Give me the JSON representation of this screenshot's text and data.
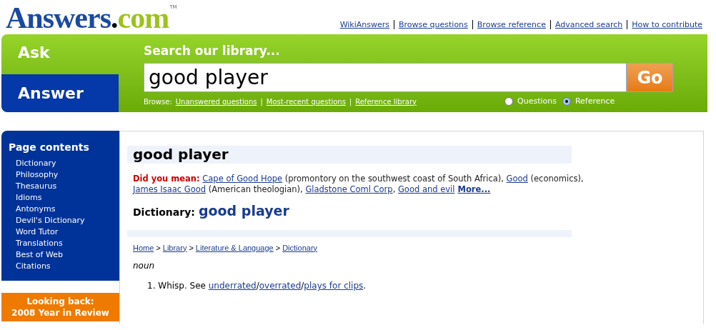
{
  "logo": {
    "parts": [
      {
        "kind": "main",
        "text": "Answers"
      },
      {
        "kind": "dot",
        "text": "."
      },
      {
        "kind": "domain",
        "text": "com"
      }
    ],
    "trademark": "TM"
  },
  "top_links": [
    "WikiAnswers",
    "Browse questions",
    "Browse reference",
    "Advanced search",
    "How to contribute"
  ],
  "tabs": [
    {
      "label": "Ask",
      "selected": false
    },
    {
      "label": "Answer",
      "selected": true
    }
  ],
  "search": {
    "heading": "Search our library...",
    "value": "good player",
    "button": "Go",
    "browse_label": "Browse:",
    "browse_links": [
      "Unanswered questions",
      "Most-recent questions",
      "Reference library"
    ],
    "browse_separator": "|",
    "scopes": [
      {
        "label": "Questions",
        "selected": false
      },
      {
        "label": "Reference",
        "selected": true
      }
    ]
  },
  "sidebar": {
    "title": "Page contents",
    "items": [
      "Dictionary",
      "Philosophy",
      "Thesaurus",
      "Idioms",
      "Antonyms",
      "Devil's Dictionary",
      "Word Tutor",
      "Translations",
      "Best of Web",
      "Citations"
    ]
  },
  "promo": [
    "Looking back:",
    "2008 Year in Review"
  ],
  "article": {
    "title": "good player",
    "did_you_mean": {
      "label": "Did you mean:",
      "segments": [
        {
          "kind": "link",
          "text": "Cape of Good Hope"
        },
        {
          "kind": "text",
          "text": " (promontory on the southwest coast of South Africa), "
        },
        {
          "kind": "link",
          "text": "Good"
        },
        {
          "kind": "text",
          "text": " (economics), "
        },
        {
          "kind": "link",
          "text": "James Isaac Good"
        },
        {
          "kind": "text",
          "text": " (American theologian), "
        },
        {
          "kind": "link",
          "text": "Gladstone Coml Corp"
        },
        {
          "kind": "text",
          "text": ", "
        },
        {
          "kind": "link",
          "text": "Good and evil"
        },
        {
          "kind": "more",
          "text": "More..."
        }
      ]
    },
    "dictionary_label": "Dictionary:",
    "dictionary_term": "good player",
    "breadcrumb": [
      "Home",
      "Library",
      "Literature & Language",
      "Dictionary"
    ],
    "breadcrumb_separator": ">",
    "part_of_speech": "noun",
    "definitions": [
      {
        "number": "1.",
        "segments": [
          {
            "kind": "text",
            "text": "Whisp. See "
          },
          {
            "kind": "link",
            "text": "underrated"
          },
          {
            "kind": "text",
            "text": "/"
          },
          {
            "kind": "link",
            "text": "overrated"
          },
          {
            "kind": "text",
            "text": "/"
          },
          {
            "kind": "link",
            "text": "plays for clips"
          },
          {
            "kind": "text",
            "text": "."
          }
        ]
      }
    ]
  }
}
